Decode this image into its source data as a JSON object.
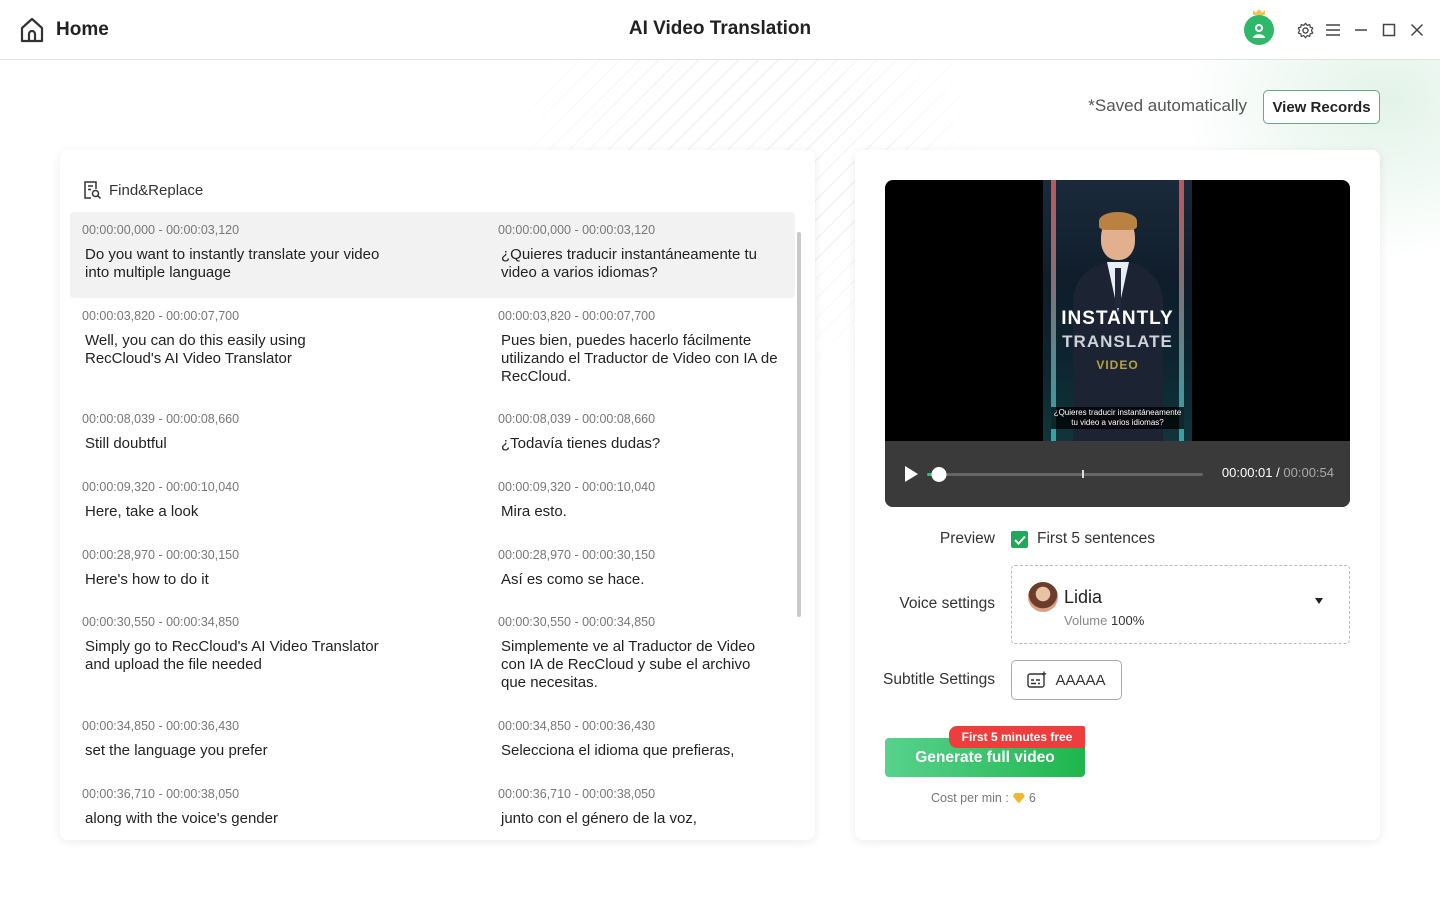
{
  "titlebar": {
    "home_label": "Home",
    "app_title": "AI Video Translation",
    "icons": [
      "home-icon",
      "user-avatar-icon",
      "settings-gear-icon",
      "menu-icon",
      "minimize-icon",
      "maximize-icon",
      "close-icon"
    ]
  },
  "toolbar": {
    "saved_text": "*Saved automatically",
    "view_records_label": "View Records"
  },
  "editor": {
    "find_replace_label": "Find&Replace",
    "rows": [
      {
        "time": "00:00:00,000 - 00:00:03,120",
        "source": "Do you want to instantly translate your video into multiple language",
        "target": "¿Quieres traducir instantáneamente tu video a varios idiomas?",
        "selected": true
      },
      {
        "time": "00:00:03,820 - 00:00:07,700",
        "source": "Well, you can do this easily using RecCloud's AI Video Translator",
        "target": "Pues bien, puedes hacerlo fácilmente utilizando el Traductor de Video con IA de RecCloud."
      },
      {
        "time": "00:00:08,039 - 00:00:08,660",
        "source": "Still doubtful",
        "target": "¿Todavía tienes dudas?"
      },
      {
        "time": "00:00:09,320 - 00:00:10,040",
        "source": "Here, take a look",
        "target": "Mira esto."
      },
      {
        "time": "00:00:28,970 - 00:00:30,150",
        "source": "Here's how to do it",
        "target": "Así es como se hace."
      },
      {
        "time": "00:00:30,550 - 00:00:34,850",
        "source": "Simply go to RecCloud's AI Video Translator and upload the file needed",
        "target": "Simplemente ve al Traductor de Video con IA de RecCloud y sube el archivo que necesitas."
      },
      {
        "time": "00:00:34,850 - 00:00:36,430",
        "source": "set the language you prefer",
        "target": "Selecciona el idioma que prefieras,"
      },
      {
        "time": "00:00:36,710 - 00:00:38,050",
        "source": "along with the voice's gender",
        "target": "junto con el género de la voz,"
      }
    ]
  },
  "player": {
    "video_title_line1": "INSTANTLY",
    "video_title_line2": "TRANSLATE",
    "video_title_line3": "VIDEO",
    "video_subtitle": "¿Quieres traducir instantáneamente tu video a varios idiomas?",
    "current_time": "00:00:01",
    "time_separator": "/",
    "duration": "00:00:54",
    "progress_fraction": 0.045
  },
  "settings": {
    "preview_label": "Preview",
    "preview_option": "First 5 sentences",
    "preview_checked": true,
    "voice_label": "Voice settings",
    "voice_name": "Lidia",
    "volume_label": "Volume",
    "volume_value": "100%",
    "subtitle_label": "Subtitle Settings",
    "subtitle_style": "AAAAA"
  },
  "generate": {
    "button_label": "Generate full video",
    "badge": "First 5 minutes free",
    "cost_label": "Cost per min :",
    "cost_value": "6"
  },
  "colors": {
    "accent_green": "#1fb64d",
    "badge_red": "#ee3d3d",
    "diamond_gold": "#f2b632"
  }
}
